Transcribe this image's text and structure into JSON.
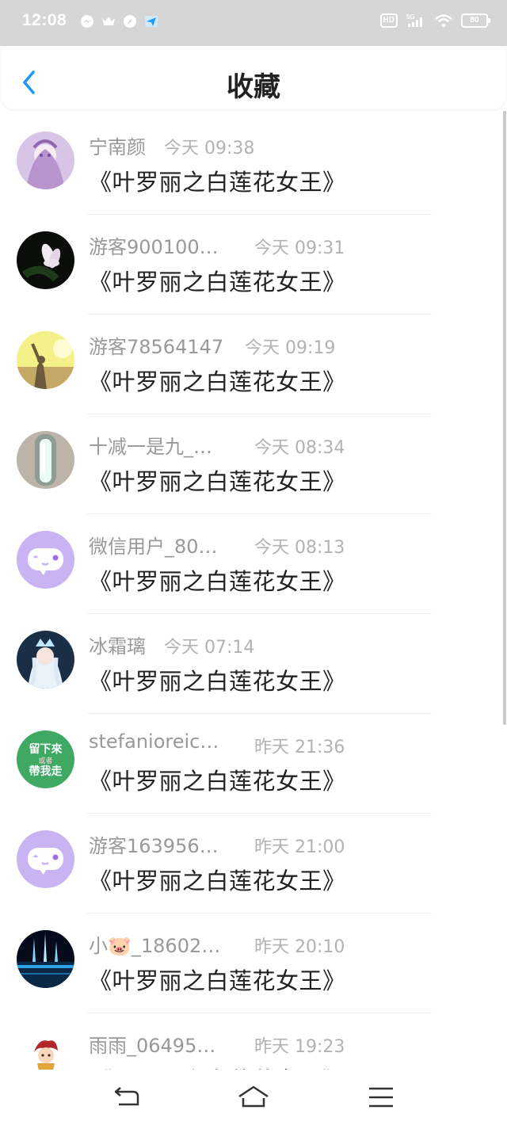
{
  "status_bar": {
    "time": "12:08",
    "signal": "5G",
    "hd": "HD",
    "battery": "80"
  },
  "header": {
    "title": "收藏"
  },
  "items": [
    {
      "user": "宁南颜",
      "time": "今天 09:38",
      "title": "《叶罗丽之白莲花女王》",
      "avatar": "anime-girl-purple"
    },
    {
      "user": "游客900100…",
      "time": "今天 09:31",
      "title": "《叶罗丽之白莲花女王》",
      "avatar": "white-lotus"
    },
    {
      "user": "游客78564147",
      "time": "今天 09:19",
      "title": "《叶罗丽之白莲花女王》",
      "avatar": "sunset-silhouette"
    },
    {
      "user": "十减一是九_…",
      "time": "今天 08:34",
      "title": "《叶罗丽之白莲花女王》",
      "avatar": "mirror-light"
    },
    {
      "user": "微信用户_80…",
      "time": "今天 08:13",
      "title": "《叶罗丽之白莲花女王》",
      "avatar": "default-chat"
    },
    {
      "user": "冰霜璃",
      "time": "今天 07:14",
      "title": "《叶罗丽之白莲花女王》",
      "avatar": "ice-princess"
    },
    {
      "user": "stefanioreic…",
      "time": "昨天 21:36",
      "title": "《叶罗丽之白莲花女王》",
      "avatar": "green-text",
      "avatar_text": [
        "留下來",
        "或者",
        "帶我走"
      ]
    },
    {
      "user": "游客163956…",
      "time": "昨天 21:00",
      "title": "《叶罗丽之白莲花女王》",
      "avatar": "default-chat"
    },
    {
      "user": "小🐷_18602…",
      "time": "昨天 20:10",
      "title": "《叶罗丽之白莲花女王》",
      "avatar": "night-blue"
    },
    {
      "user": "雨雨_06495…",
      "time": "昨天 19:23",
      "title": "《叶罗丽之白莲花女王》",
      "avatar": "chibi-red"
    }
  ],
  "colors": {
    "accent": "#2196f3",
    "status_bar_bg": "#d6d6d6",
    "name_text": "#999999",
    "time_text": "#b2b2b2",
    "title_text": "#222222",
    "default_avatar": "#c9b3f3"
  },
  "nav": {
    "icons": [
      "back-icon",
      "home-icon",
      "menu-icon"
    ]
  }
}
